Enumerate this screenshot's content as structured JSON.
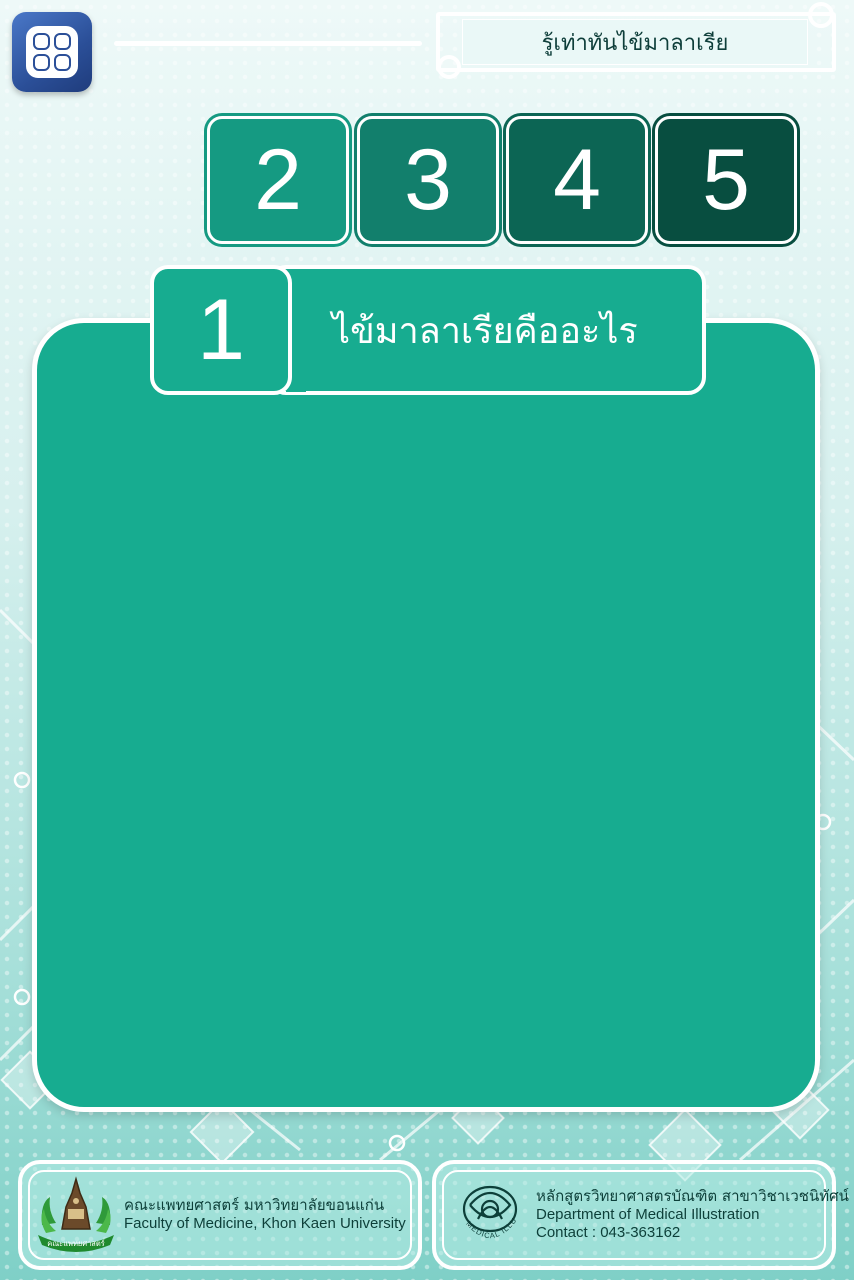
{
  "header": {
    "title": "รู้เท่าทันไข้มาลาเรีย"
  },
  "tabs": [
    {
      "label": "2",
      "color": "#159a82"
    },
    {
      "label": "3",
      "color": "#127f6c"
    },
    {
      "label": "4",
      "color": "#0c6554"
    },
    {
      "label": "5",
      "color": "#084e40"
    }
  ],
  "section": {
    "number": "1",
    "title": "ไข้มาลาเรียคืออะไร",
    "color": "#17ac90"
  },
  "footer": {
    "left": {
      "line1": "คณะแพทยศาสตร์ มหาวิทยาลัยขอนแก่น",
      "line2": "Faculty of Medicine, Khon Kaen University",
      "logo_ribbon": "คณะแพทยศาสตร์"
    },
    "right": {
      "line1": "หลักสูตรวิทยาศาสตรบัณฑิต สาขาวิชาเวชนิทัศน์",
      "line2": "Department of Medical Illustration",
      "line3": "Contact : 043-363162",
      "logo_text": "MEDICAL ILLUSTRATION"
    }
  }
}
